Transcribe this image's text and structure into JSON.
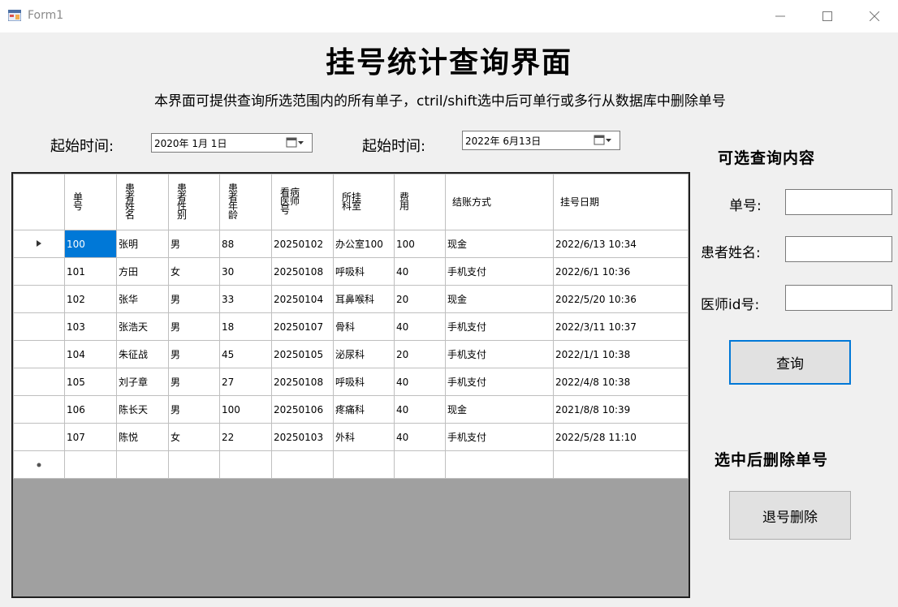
{
  "window": {
    "title": "Form1"
  },
  "header": {
    "title": "挂号统计查询界面",
    "subtitle": "本界面可提供查询所选范围内的所有单子，ctril/shift选中后可单行或多行从数据库中删除单号"
  },
  "date_range": {
    "start_label": "起始时间:",
    "start_value": "2020年 1月 1日",
    "end_label": "起始时间:",
    "end_value": "2022年 6月13日"
  },
  "grid": {
    "columns": [
      "单号",
      "患者姓名",
      "患者性别",
      "患者年龄",
      "看病医师号",
      "所挂科室",
      "费用",
      "结账方式",
      "挂号日期"
    ],
    "rows": [
      [
        "100",
        "张明",
        "男",
        "88",
        "20250102",
        "办公室100",
        "100",
        "现金",
        "2022/6/13 10:34"
      ],
      [
        "101",
        "方田",
        "女",
        "30",
        "20250108",
        "呼吸科",
        "40",
        "手机支付",
        "2022/6/1 10:36"
      ],
      [
        "102",
        "张华",
        "男",
        "33",
        "20250104",
        "耳鼻喉科",
        "20",
        "现金",
        "2022/5/20 10:36"
      ],
      [
        "103",
        "张浩天",
        "男",
        "18",
        "20250107",
        "骨科",
        "40",
        "手机支付",
        "2022/3/11 10:37"
      ],
      [
        "104",
        "朱征战",
        "男",
        "45",
        "20250105",
        "泌尿科",
        "20",
        "手机支付",
        "2022/1/1 10:38"
      ],
      [
        "105",
        "刘子章",
        "男",
        "27",
        "20250108",
        "呼吸科",
        "40",
        "手机支付",
        "2022/4/8 10:38"
      ],
      [
        "106",
        "陈长天",
        "男",
        "100",
        "20250106",
        "疼痛科",
        "40",
        "现金",
        "2021/8/8 10:39"
      ],
      [
        "107",
        "陈悦",
        "女",
        "22",
        "20250103",
        "外科",
        "40",
        "手机支付",
        "2022/5/28 11:10"
      ]
    ]
  },
  "query_panel": {
    "title": "可选查询内容",
    "order_label": "单号:",
    "patient_label": "患者姓名:",
    "doctor_label": "医师id号:",
    "order_value": "",
    "patient_value": "",
    "doctor_value": "",
    "query_button": "查询"
  },
  "delete_panel": {
    "title": "选中后删除单号",
    "delete_button": "退号删除"
  }
}
